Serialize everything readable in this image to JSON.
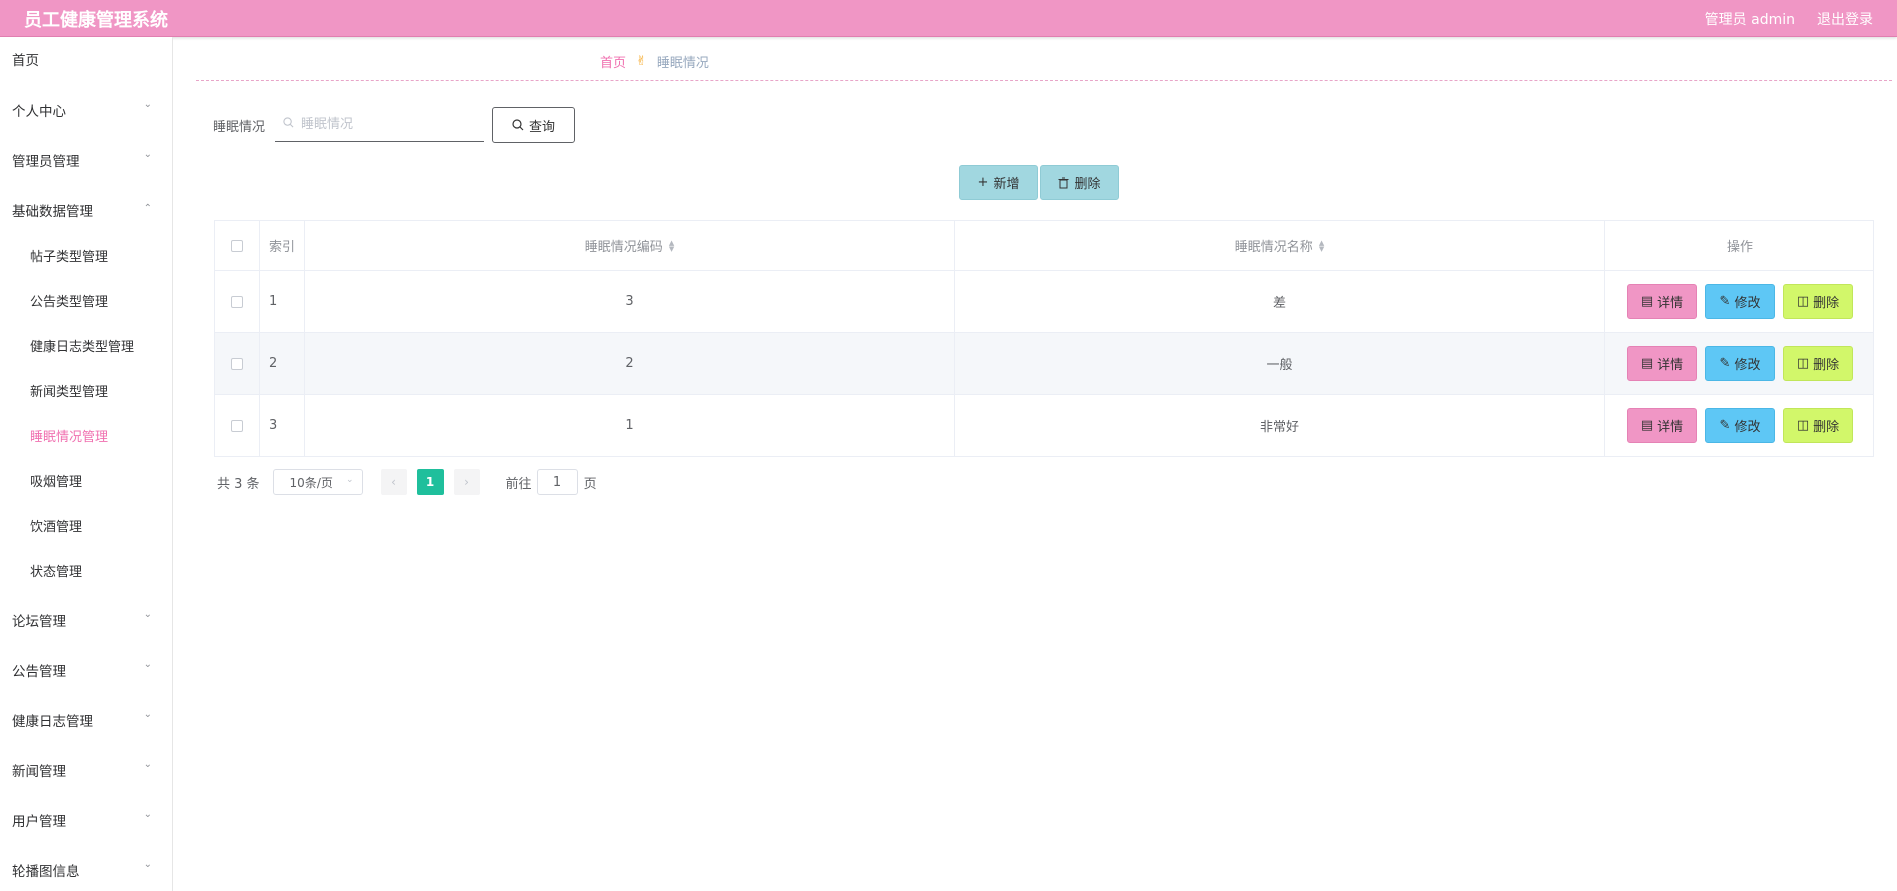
{
  "header": {
    "title": "员工健康管理系统",
    "user": "管理员 admin",
    "logout": "退出登录"
  },
  "sidebar": {
    "items": [
      {
        "label": "首页"
      },
      {
        "label": "个人中心"
      },
      {
        "label": "管理员管理"
      },
      {
        "label": "基础数据管理"
      },
      {
        "label": "论坛管理"
      },
      {
        "label": "公告管理"
      },
      {
        "label": "健康日志管理"
      },
      {
        "label": "新闻管理"
      },
      {
        "label": "用户管理"
      },
      {
        "label": "轮播图信息"
      }
    ],
    "sub_items": [
      {
        "label": "帖子类型管理"
      },
      {
        "label": "公告类型管理"
      },
      {
        "label": "健康日志类型管理"
      },
      {
        "label": "新闻类型管理"
      },
      {
        "label": "睡眠情况管理"
      },
      {
        "label": "吸烟管理"
      },
      {
        "label": "饮酒管理"
      },
      {
        "label": "状态管理"
      }
    ]
  },
  "breadcrumb": {
    "home": "首页",
    "current": "睡眠情况"
  },
  "search": {
    "label": "睡眠情况",
    "placeholder": "睡眠情况",
    "button": "查询"
  },
  "actions": {
    "add": "新增",
    "delete": "删除"
  },
  "table": {
    "headers": {
      "index": "索引",
      "code": "睡眠情况编码",
      "name": "睡眠情况名称",
      "ops": "操作"
    },
    "rows": [
      {
        "index": "1",
        "code": "3",
        "name": "差"
      },
      {
        "index": "2",
        "code": "2",
        "name": "一般"
      },
      {
        "index": "3",
        "code": "1",
        "name": "非常好"
      }
    ],
    "op_labels": {
      "detail": "详情",
      "edit": "修改",
      "delete": "删除"
    }
  },
  "pagination": {
    "total": "共 3 条",
    "page_size": "10条/页",
    "current": "1",
    "goto_label": "前往",
    "goto_value": "1",
    "unit": "页"
  },
  "colors": {
    "header": "#f096c5",
    "active_menu": "#f070b0",
    "action_button": "#a1d7e0",
    "detail": "#f096c5",
    "edit": "#5ec7f5",
    "delete": "#d2f76a",
    "page_active": "#1fbf9c"
  }
}
